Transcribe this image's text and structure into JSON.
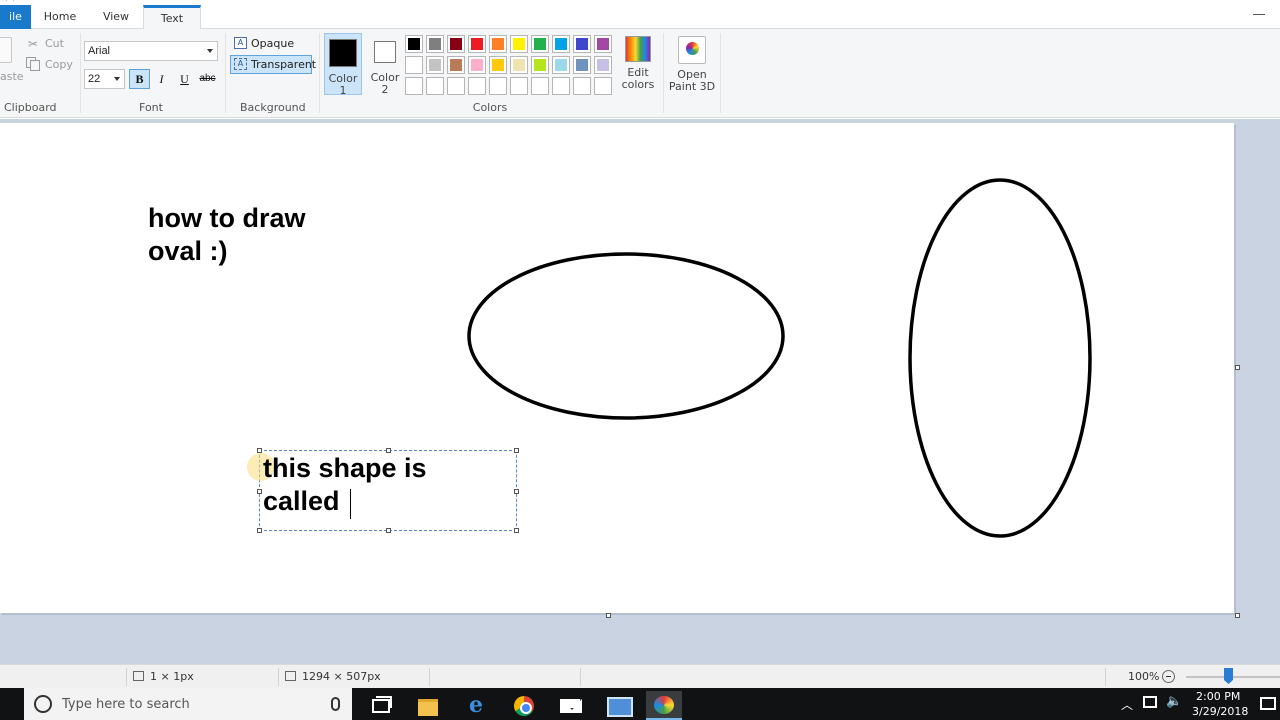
{
  "tabs": {
    "file": "ile",
    "home": "Home",
    "view": "View",
    "text": "Text"
  },
  "clipboard": {
    "paste_label": "aste",
    "cut_label": "Cut",
    "copy_label": "Copy",
    "group_label": "Clipboard"
  },
  "font": {
    "name": "Arial",
    "size": "22",
    "bold_label": "B",
    "italic_label": "I",
    "underline_label": "U",
    "strike_label": "abc",
    "group_label": "Font"
  },
  "background": {
    "opaque_label": "Opaque",
    "transparent_label": "Transparent",
    "group_label": "Background",
    "selected": "Transparent"
  },
  "colors": {
    "color1_line1": "Color",
    "color1_line2": "1",
    "color1_value": "#000000",
    "color2_line1": "Color",
    "color2_line2": "2",
    "color2_value": "#ffffff",
    "edit_line1": "Edit",
    "edit_line2": "colors",
    "group_label": "Colors",
    "palette_row1": [
      "#000000",
      "#7f7f7f",
      "#880015",
      "#ed1c24",
      "#ff7f27",
      "#fff200",
      "#22b14c",
      "#00a2e8",
      "#3f48cc",
      "#a349a4"
    ],
    "palette_row2": [
      "#ffffff",
      "#c3c3c3",
      "#b97a57",
      "#ffaec9",
      "#ffc90e",
      "#efe4b0",
      "#b5e61d",
      "#99d9ea",
      "#7092be",
      "#c8bfe7"
    ],
    "palette_row3": [
      "",
      "",
      "",
      "",
      "",
      "",
      "",
      "",
      "",
      ""
    ]
  },
  "paint3d": {
    "line1": "Open",
    "line2": "Paint 3D"
  },
  "canvas": {
    "heading_line1": "how to draw",
    "heading_line2": "oval :)",
    "textbox_line1": "this shape is",
    "textbox_line2": "called"
  },
  "status": {
    "selection_size": "1 × 1px",
    "canvas_size": "1294 × 507px",
    "zoom": "100%",
    "zoom_level": 1.0
  },
  "taskbar": {
    "search_placeholder": "Type here to search",
    "time": "2:00 PM",
    "date": "3/29/2018"
  }
}
